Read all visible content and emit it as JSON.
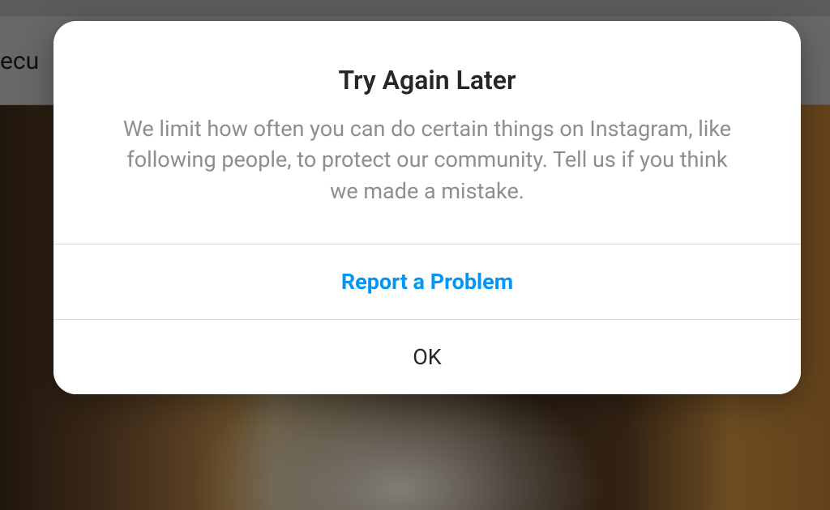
{
  "background": {
    "partial_text": "ecu"
  },
  "modal": {
    "title": "Try Again Later",
    "message": "We limit how often you can do certain things on Instagram, like following people, to protect our community. Tell us if you think we made a mistake.",
    "primary_button_label": "Report a Problem",
    "secondary_button_label": "OK"
  },
  "colors": {
    "accent": "#0095f6",
    "text_primary": "#262626",
    "text_secondary": "#8e8e8e",
    "divider": "#dbdbdb"
  }
}
